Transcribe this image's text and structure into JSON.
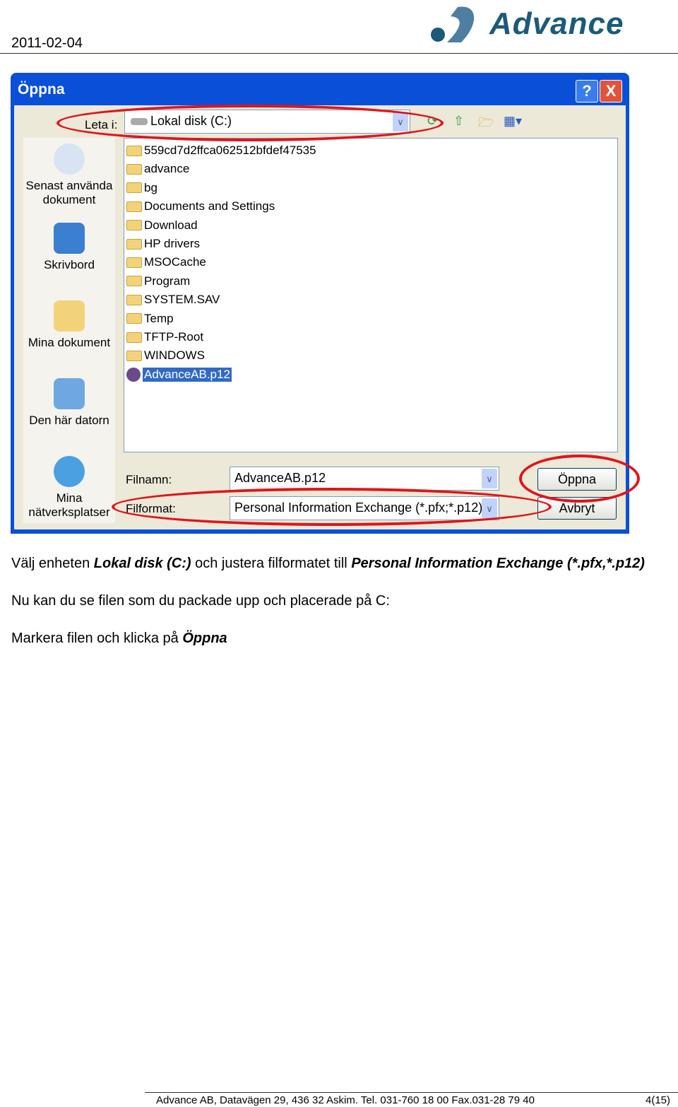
{
  "header": {
    "date": "2011-02-04",
    "logo_text": "Advance"
  },
  "dialog": {
    "title": "Öppna",
    "help_label": "?",
    "close_label": "X",
    "look_in_label": "Leta i:",
    "look_in_value": "Lokal disk (C:)",
    "places": [
      {
        "label": "Senast använda dokument",
        "icon": "recent-documents-icon"
      },
      {
        "label": "Skrivbord",
        "icon": "desktop-icon"
      },
      {
        "label": "Mina dokument",
        "icon": "my-documents-icon"
      },
      {
        "label": "Den här datorn",
        "icon": "my-computer-icon"
      },
      {
        "label": "Mina nätverksplatser",
        "icon": "network-places-icon"
      }
    ],
    "files": [
      "559cd7d2ffca062512bfdef47535",
      "advance",
      "bg",
      "Documents and Settings",
      "Download",
      "HP drivers",
      "MSOCache",
      "Program",
      "SYSTEM.SAV",
      "Temp",
      "TFTP-Root",
      "WINDOWS",
      "AdvanceAB.p12"
    ],
    "selected_file": "AdvanceAB.p12",
    "filename_label": "Filnamn:",
    "filename_value": "AdvanceAB.p12",
    "filetype_label": "Filformat:",
    "filetype_value": "Personal Information Exchange (*.pfx;*.p12)",
    "open_button": "Öppna",
    "cancel_button": "Avbryt",
    "highlight_color": "#e0141b"
  },
  "instructions": [
    {
      "parts": [
        {
          "t": "Välj enheten ",
          "b": false
        },
        {
          "t": "Lokal disk (C:)",
          "b": true
        },
        {
          "t": " och justera filformatet till ",
          "b": false
        },
        {
          "t": "Personal Information Exchange (*.pfx,*.p12)",
          "b": true
        }
      ]
    },
    {
      "parts": [
        {
          "t": "Nu kan du se filen som du packade upp och placerade på C:",
          "b": false
        }
      ]
    },
    {
      "parts": [
        {
          "t": "Markera filen och klicka på ",
          "b": false
        },
        {
          "t": "Öppna",
          "b": true
        }
      ]
    }
  ],
  "footer": {
    "address": "Advance AB, Datavägen 29, 436 32 Askim. Tel. 031-760 18 00 Fax.031-28 79 40",
    "page": "4(15)"
  }
}
